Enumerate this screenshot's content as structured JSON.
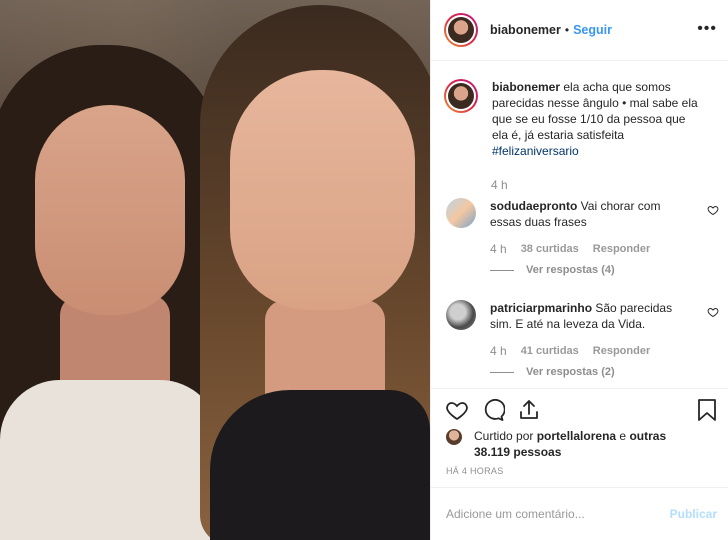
{
  "post": {
    "username": "biabonemer",
    "follow_separator": "•",
    "follow_label": "Seguir",
    "more_label": "•••"
  },
  "caption": {
    "username": "biabonemer",
    "text": "ela acha que somos parecidas nesse ângulo • mal sabe ela que se eu fosse 1/10 da pessoa que ela é, já estaria satisfeita",
    "hashtag": "#felizaniversario",
    "time": "4 h"
  },
  "comments": [
    {
      "username": "sodudaepronto",
      "text": "Vai chorar com essas duas frases",
      "time": "4 h",
      "likes": "38 curtidas",
      "reply_label": "Responder",
      "view_replies": "Ver respostas (4)"
    },
    {
      "username": "patriciarpmarinho",
      "text": "São parecidas sim. E até na leveza da Vida.",
      "time": "4 h",
      "likes": "41 curtidas",
      "reply_label": "Responder",
      "view_replies": "Ver respostas (2)"
    }
  ],
  "likes": {
    "prefix": "Curtido por",
    "user": "portellalorena",
    "connector": "e",
    "others": "outras 38.119 pessoas"
  },
  "age": "HÁ 4 HORAS",
  "comment_box": {
    "placeholder": "Adicione um comentário...",
    "post_label": "Publicar"
  },
  "icons": [
    "heart-icon",
    "comment-icon",
    "share-icon",
    "bookmark-icon",
    "more-icon",
    "small-heart-icon"
  ],
  "colors": {
    "accent": "#3897f0",
    "hashtag": "#003569",
    "muted": "#8e8e8e",
    "post_disabled": "#b2dffc"
  }
}
